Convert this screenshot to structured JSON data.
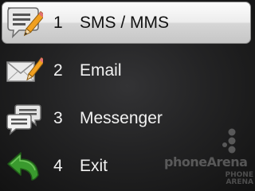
{
  "menu": {
    "items": [
      {
        "number": "1",
        "label": "SMS / MMS",
        "icon": "sms-compose-icon",
        "selected": true
      },
      {
        "number": "2",
        "label": "Email",
        "icon": "envelope-pencil-icon",
        "selected": false
      },
      {
        "number": "3",
        "label": "Messenger",
        "icon": "chat-bubbles-icon",
        "selected": false
      },
      {
        "number": "4",
        "label": "Exit",
        "icon": "back-arrow-icon",
        "selected": false
      }
    ]
  },
  "watermark": {
    "brand": "phoneArena",
    "sub_line1": "PHONE",
    "sub_line2": "ARENA"
  },
  "colors": {
    "selection_highlight": "#f5f5f5",
    "background": "#232324",
    "text": "#f2f2f2",
    "selected_text": "#111111",
    "exit_arrow": "#3a9a2e"
  }
}
